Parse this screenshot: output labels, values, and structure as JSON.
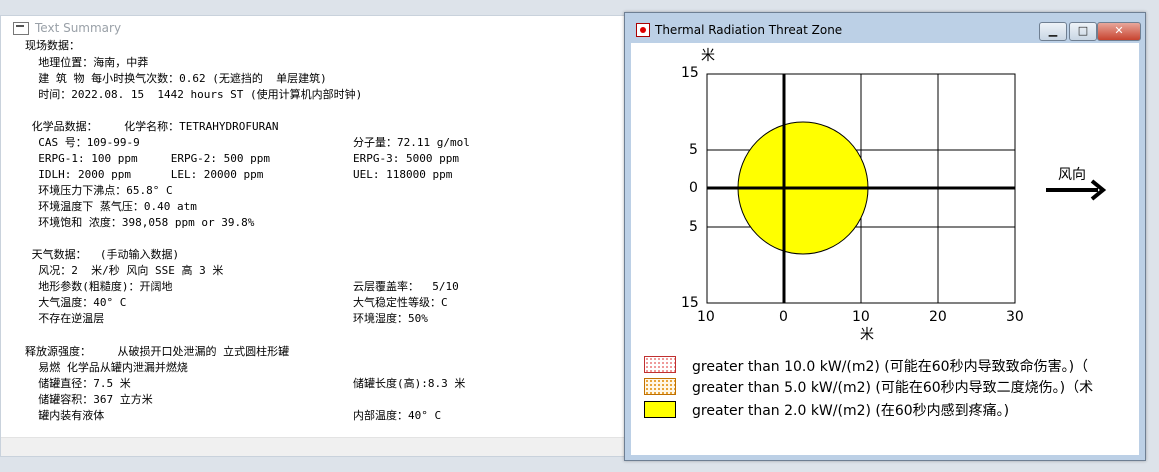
{
  "summary_window": {
    "title": "Text Summary",
    "lines": [
      "现场数据：",
      "  地理位置：海南，中莽",
      "  建 筑 物 每小时换气次数：0.62 (无遮挡的  单层建筑)",
      "  时间：2022.08. 15  1442 hours ST (使用计算机内部时钟)",
      "",
      " 化学品数据：    化学名称：TETRAHYDROFURAN",
      "  CAS 号：109-99-9",
      "  ERPG-1: 100 ppm     ERPG-2: 500 ppm",
      "  IDLH: 2000 ppm      LEL: 20000 ppm",
      "  环境压力下沸点：65.8° C",
      "  环境温度下 蒸气压：0.40 atm",
      "  环境饱和 浓度：398,058 ppm or 39.8%",
      "",
      " 天气数据：  (手动输入数据)",
      "  风况：2  米/秒 风向 SSE 高 3 米",
      "  地形参数(粗糙度)：开阔地",
      "  大气温度：40° C",
      "  不存在逆温层",
      "",
      "释放源强度：    从破损开口处泄漏的 立式圆柱形罐",
      "  易燃 化学品从罐内泄漏并燃烧",
      "  储罐直径：7.5 米",
      "  储罐容积：367 立方米",
      "  罐内装有液体"
    ],
    "right_column": {
      "molar_mass": "分子量：72.11 g/mol",
      "erpg3": "ERPG-3: 5000 ppm",
      "uel": "UEL: 118000 ppm",
      "cloud_cover": "云层覆盖率：  5/10",
      "stability": "大气稳定性等级：C",
      "humidity": "环境湿度：50%",
      "tank_length": "储罐长度(高):8.3 米",
      "internal_temp": "内部温度：40° C"
    }
  },
  "threat_window": {
    "title": "Thermal Radiation Threat Zone",
    "buttons": {
      "minimize": "▁",
      "maximize": "□",
      "close": "✕"
    },
    "y_unit": "米",
    "x_unit": "米",
    "y_ticks": [
      "15",
      "5",
      "0",
      "5",
      "15"
    ],
    "x_ticks": [
      "10",
      "0",
      "10",
      "20",
      "30"
    ],
    "wind_label": "风向",
    "legend": [
      {
        "label": "greater than 10.0 kW/(m2) (可能在60秒内导致致命伤害。)（",
        "color": "#ff9a9a",
        "pattern": "red-dots"
      },
      {
        "label": "greater than 5.0 kW/(m2) (可能在60秒内导致二度烧伤。)（术",
        "color": "#f5b04a",
        "pattern": "orange-dots"
      },
      {
        "label": "greater than 2.0 kW/(m2) (在60秒内感到疼痛。)",
        "color": "#ffff00",
        "pattern": "solid"
      }
    ]
  }
}
